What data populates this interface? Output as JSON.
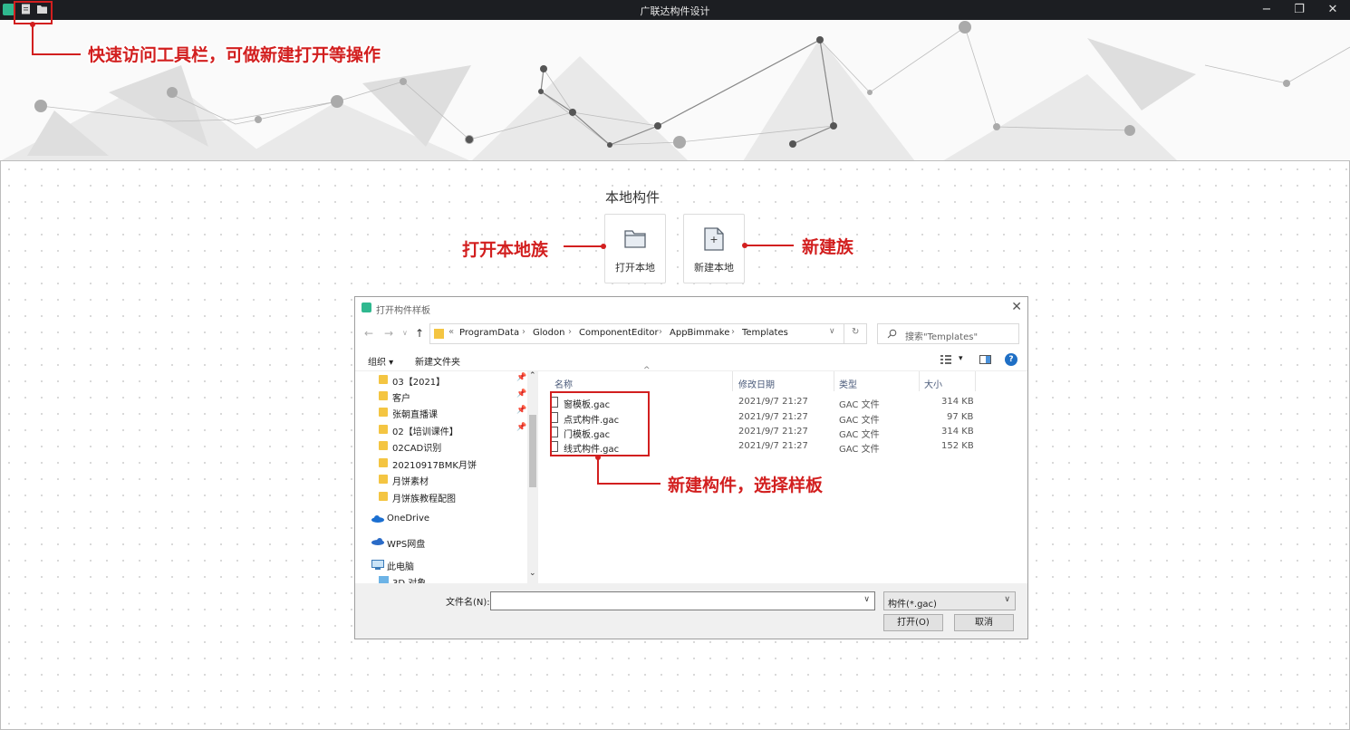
{
  "window": {
    "title": "广联达构件设计",
    "minimize": "−",
    "restore": "❐",
    "close": "✕"
  },
  "annotations": {
    "quick_access": "快速访问工具栏，可做新建打开等操作",
    "open_local": "打开本地族",
    "new_family": "新建族",
    "new_component": "新建构件，选择样板"
  },
  "section": {
    "title": "本地构件",
    "open_card_label": "打开本地",
    "new_card_label": "新建本地",
    "plus": "+"
  },
  "dialog": {
    "title": "打开构件样板",
    "close": "✕",
    "nav": {
      "back": "←",
      "forward": "→",
      "down": "∨",
      "up": "↑"
    },
    "address": {
      "overflow": "«",
      "segments": [
        "ProgramData",
        "Glodon",
        "ComponentEditor",
        "AppBimmake",
        "Templates"
      ],
      "separator": "›",
      "dropdown": "∨",
      "refresh": "↻"
    },
    "search_placeholder": "搜索\"Templates\"",
    "toolbar": {
      "organize": "组织 ▾",
      "new_folder": "新建文件夹",
      "view": "▾",
      "help": "?"
    },
    "nav_folders": [
      {
        "label": "03【2021】",
        "pinned": true
      },
      {
        "label": "客户",
        "pinned": true
      },
      {
        "label": "张朝直播课",
        "pinned": true
      },
      {
        "label": "02【培训课件】",
        "pinned": true
      },
      {
        "label": "02CAD识别",
        "pinned": false
      },
      {
        "label": "20210917BMK月饼",
        "pinned": false
      },
      {
        "label": "月饼素材",
        "pinned": false
      },
      {
        "label": "月饼族教程配图",
        "pinned": false
      }
    ],
    "nav_places": [
      "OneDrive",
      "WPS网盘",
      "此电脑",
      "3D 对象"
    ],
    "pin_icon": "📌",
    "scroll_up": "⌃",
    "scroll_down": "⌄",
    "columns": {
      "name": "名称",
      "modified": "修改日期",
      "type": "类型",
      "size": "大小"
    },
    "files": [
      {
        "name": "窗模板.gac",
        "modified": "2021/9/7 21:27",
        "type": "GAC 文件",
        "size": "314 KB"
      },
      {
        "name": "点式构件.gac",
        "modified": "2021/9/7 21:27",
        "type": "GAC 文件",
        "size": "97 KB"
      },
      {
        "name": "门模板.gac",
        "modified": "2021/9/7 21:27",
        "type": "GAC 文件",
        "size": "314 KB"
      },
      {
        "name": "线式构件.gac",
        "modified": "2021/9/7 21:27",
        "type": "GAC 文件",
        "size": "152 KB"
      }
    ],
    "filename_label": "文件名(N):",
    "filename_value": "",
    "filetype": "构件(*.gac)",
    "open_button": "打开(O)",
    "cancel_button": "取消"
  }
}
